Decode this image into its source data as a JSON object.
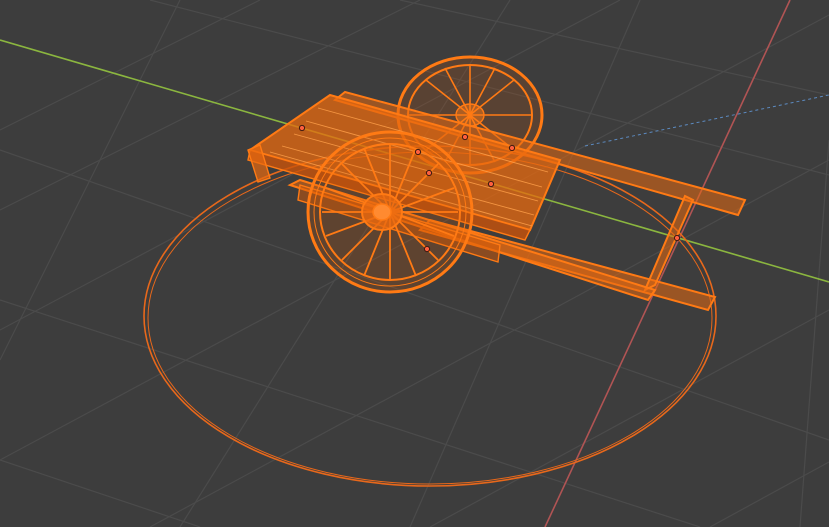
{
  "viewport": {
    "mode": "3d-viewport-wireframe",
    "background_color": "#3d3d3d",
    "grid_color": "#4e4e4e",
    "x_axis_color": "#8bb63f",
    "y_axis_color": "#b05454",
    "selection_color": "#ff7a14",
    "selection_dark": "#d85a06",
    "vertex_color": "#ff5f3f"
  },
  "scene": {
    "selected_object": "cart-model",
    "extra_object": "circle-outline"
  }
}
